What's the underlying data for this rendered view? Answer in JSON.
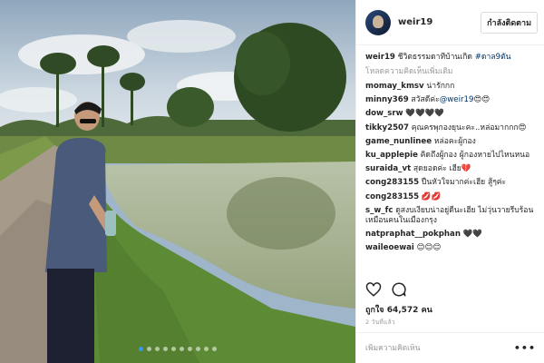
{
  "post": {
    "username": "weir19",
    "follow_label": "กำลังติดตาม",
    "caption_text": "ชีวิตธรรมดาที่บ้านเกิด",
    "caption_hashtag": "#ดาล9ตัน",
    "load_more": "โหลดความคิดเห็นเพิ่มเติม",
    "likes": "ถูกใจ 64,572 คน",
    "time": "2 วันที่แล้ว",
    "comment_placeholder": "เพิ่มความคิดเห็น",
    "more_label": "•••",
    "photo_dots": 10,
    "photo_active_dot": 0
  },
  "comments": [
    {
      "user": "momay_kmsv",
      "text": "น่ารักกก"
    },
    {
      "user": "minny369",
      "text": "สวัสดีค่ะ",
      "mention": "@weir19",
      "emoji": "😍😍"
    },
    {
      "user": "dow_srw",
      "text": "🖤🖤🖤🖤"
    },
    {
      "user": "tikky2507",
      "text": "คุณครพุกองยุนะคะ..หล่อมากกก😍"
    },
    {
      "user": "game_nunlinee",
      "text": "หล่อคะผู้กอง"
    },
    {
      "user": "ku_applepie",
      "text": "คิดถึงผู้กอง ผู้กองหายไปไหนหนอ"
    },
    {
      "user": "suraida_vt",
      "text": "สุดยอดค่ะ เฮีย💔"
    },
    {
      "user": "cong283155",
      "text": "ปืนหัวใจมากค่ะเฮีย สู้ๆค่ะ"
    },
    {
      "user": "cong283155",
      "text": "💋💋"
    },
    {
      "user": "s_w_fc",
      "text": "ดูสงบเงียบน่าอยู่ดีนะเฮีย ไม่วุ่นวายรีบร้อนเหมือนคนในเมืองกรุง"
    },
    {
      "user": "natpraphat__pokphan",
      "text": "🖤🖤"
    },
    {
      "user": "waileoewai",
      "text": "😊😊😊"
    }
  ],
  "icons": {
    "like": "heart-icon",
    "comment": "comment-bubble-icon",
    "more": "more-options-icon"
  },
  "colors": {
    "link": "#003569",
    "muted": "#999999",
    "dot_active": "#3897f0"
  }
}
